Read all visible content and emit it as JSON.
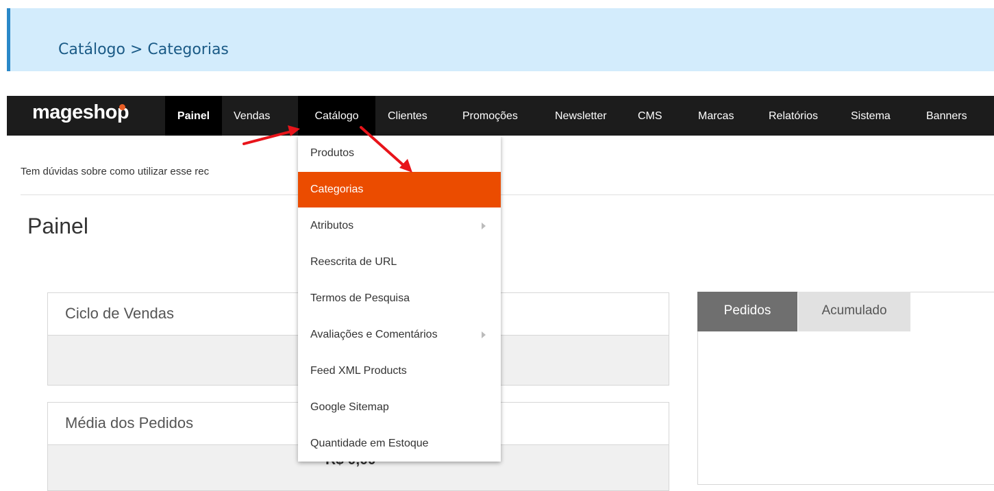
{
  "breadcrumb": {
    "text": "Catálogo > Categorias"
  },
  "logo": {
    "text": "mageshop"
  },
  "nav": {
    "items": [
      {
        "label": "Painel"
      },
      {
        "label": "Vendas"
      },
      {
        "label": "Catálogo"
      },
      {
        "label": "Clientes"
      },
      {
        "label": "Promoções"
      },
      {
        "label": "Newsletter"
      },
      {
        "label": "CMS"
      },
      {
        "label": "Marcas"
      },
      {
        "label": "Relatórios"
      },
      {
        "label": "Sistema"
      },
      {
        "label": "Banners"
      }
    ]
  },
  "help": {
    "text": "Tem dúvidas sobre como utilizar esse rec"
  },
  "page": {
    "title": "Painel"
  },
  "boxes": {
    "ciclo": {
      "title": "Ciclo de Vendas"
    },
    "media": {
      "title": "Média dos Pedidos",
      "value": "R$ 0,00"
    }
  },
  "tabs": {
    "pedidos": "Pedidos",
    "acumulado": "Acumulado"
  },
  "dropdown": {
    "items": [
      {
        "label": "Produtos"
      },
      {
        "label": "Categorias"
      },
      {
        "label": "Atributos"
      },
      {
        "label": "Reescrita de URL"
      },
      {
        "label": "Termos de Pesquisa"
      },
      {
        "label": "Avaliações e Comentários"
      },
      {
        "label": "Feed XML Products"
      },
      {
        "label": "Google Sitemap"
      },
      {
        "label": "Quantidade em Estoque"
      }
    ]
  },
  "colors": {
    "accent": "#eb4c00",
    "navbar": "#1c1c1c",
    "breadcrumb_bg": "#d3ecfc",
    "annotation_arrow": "#e8141a"
  },
  "icons": [
    "chevron-right-icon",
    "red-arrow-annotation"
  ]
}
